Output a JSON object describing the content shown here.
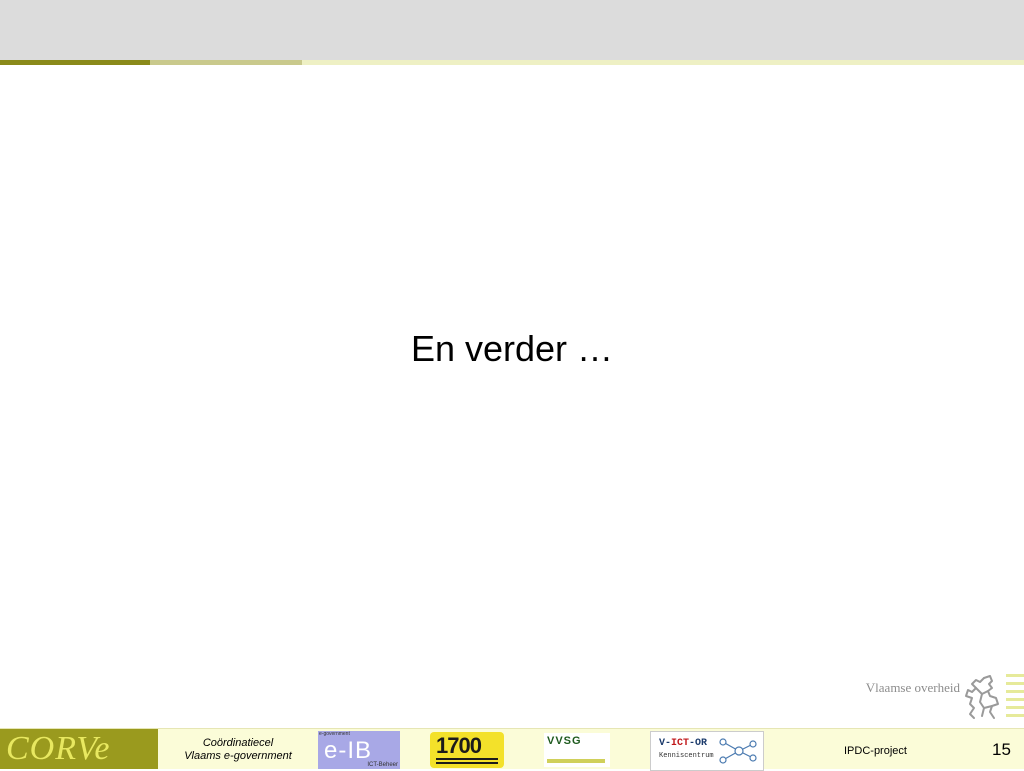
{
  "slide": {
    "body_text": "En verder …",
    "page_number": "15"
  },
  "header": {
    "stripe_colors": [
      "#8a8a1a",
      "#c9c98c",
      "#eef0c4"
    ],
    "background": "#dcdcdc"
  },
  "branding": {
    "vlaamse_overheid": "Vlaamse overheid",
    "lion_icon": "flemish-lion-icon"
  },
  "footer": {
    "corve_logo_text": "CORVe",
    "coordination_line1": "Coördinatiecel",
    "coordination_line2": "Vlaams e-government",
    "eib_logo": {
      "top": "e-government",
      "main": "e-IB",
      "sub": "ICT-Beheer"
    },
    "logo_1700": "1700",
    "vvsg_logo": "VVSG",
    "victor_logo": {
      "prefix": "V-",
      "middle": "ICT",
      "suffix": "-OR",
      "sub": "Kenniscentrum"
    },
    "project_label": "IPDC-project"
  }
}
